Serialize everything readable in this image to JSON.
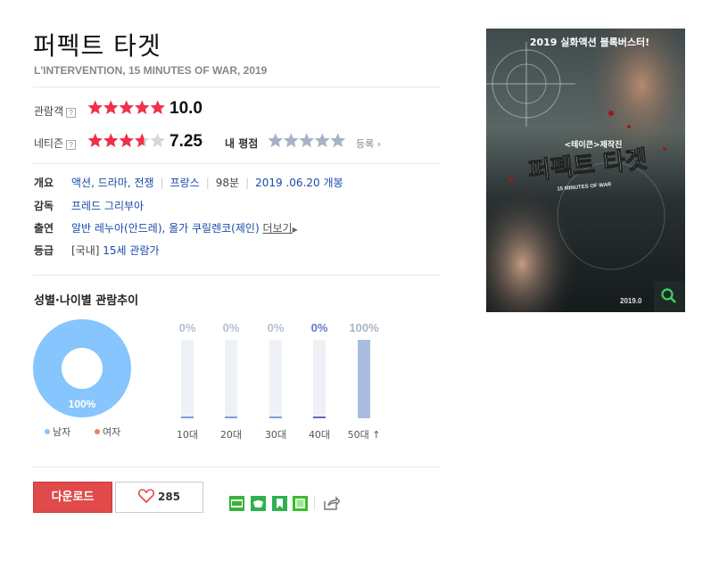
{
  "movie": {
    "title": "퍼펙트 타겟",
    "subtitle": "L'INTERVENTION, 15 MINUTES OF WAR, 2019"
  },
  "ratings": {
    "audience_label": "관람객",
    "audience_score": "10.0",
    "audience_stars": 5,
    "netizen_label": "네티즌",
    "netizen_score": "7.25",
    "netizen_stars": 3.625,
    "my_rating_label": "내 평점",
    "register_label": "등록",
    "help_mark": "?"
  },
  "info": {
    "overview_key": "개요",
    "genres": "액션, 드라마, 전쟁",
    "country": "프랑스",
    "runtime": "98분",
    "release": "2019 .06.20 개봉",
    "director_key": "감독",
    "director": "프레드 그리부아",
    "cast_key": "출연",
    "cast": "알반 레누아(안드레), 올가 쿠릴렌코(제인)",
    "cast_more": "더보기",
    "grade_key": "등급",
    "grade_prefix": "[국내]",
    "grade": "15세 관람가"
  },
  "trend": {
    "title": "성별·나이별 관람추이",
    "pie_label": "100%",
    "male_label": "남자",
    "female_label": "여자",
    "male_color": "#86c5fd",
    "female_color": "#f07c6b",
    "ages": [
      {
        "label": "10대",
        "pct": "0%",
        "value": 0
      },
      {
        "label": "20대",
        "pct": "0%",
        "value": 0
      },
      {
        "label": "30대",
        "pct": "0%",
        "value": 0
      },
      {
        "label": "40대",
        "pct": "0%",
        "value": 0
      },
      {
        "label": "50대",
        "pct": "100%",
        "value": 100
      }
    ]
  },
  "actions": {
    "download_label": "다운로드",
    "like_count": "285",
    "share_icons": [
      "blog-icon",
      "cafe-icon",
      "bookmark-icon",
      "memo-icon"
    ],
    "share_colors": [
      "#3bb23b",
      "#2eb24f",
      "#2eb24f",
      "#34c124"
    ]
  },
  "poster": {
    "top_text": "2019 실화액션 블록버스터!",
    "credit_text": "<테이큰>제작진",
    "title_text": "퍼펙트 타겟",
    "sub_text": "15 MINUTES OF WAR",
    "corner_text": "2019.0",
    "zoom_icon": "magnifier-icon"
  }
}
